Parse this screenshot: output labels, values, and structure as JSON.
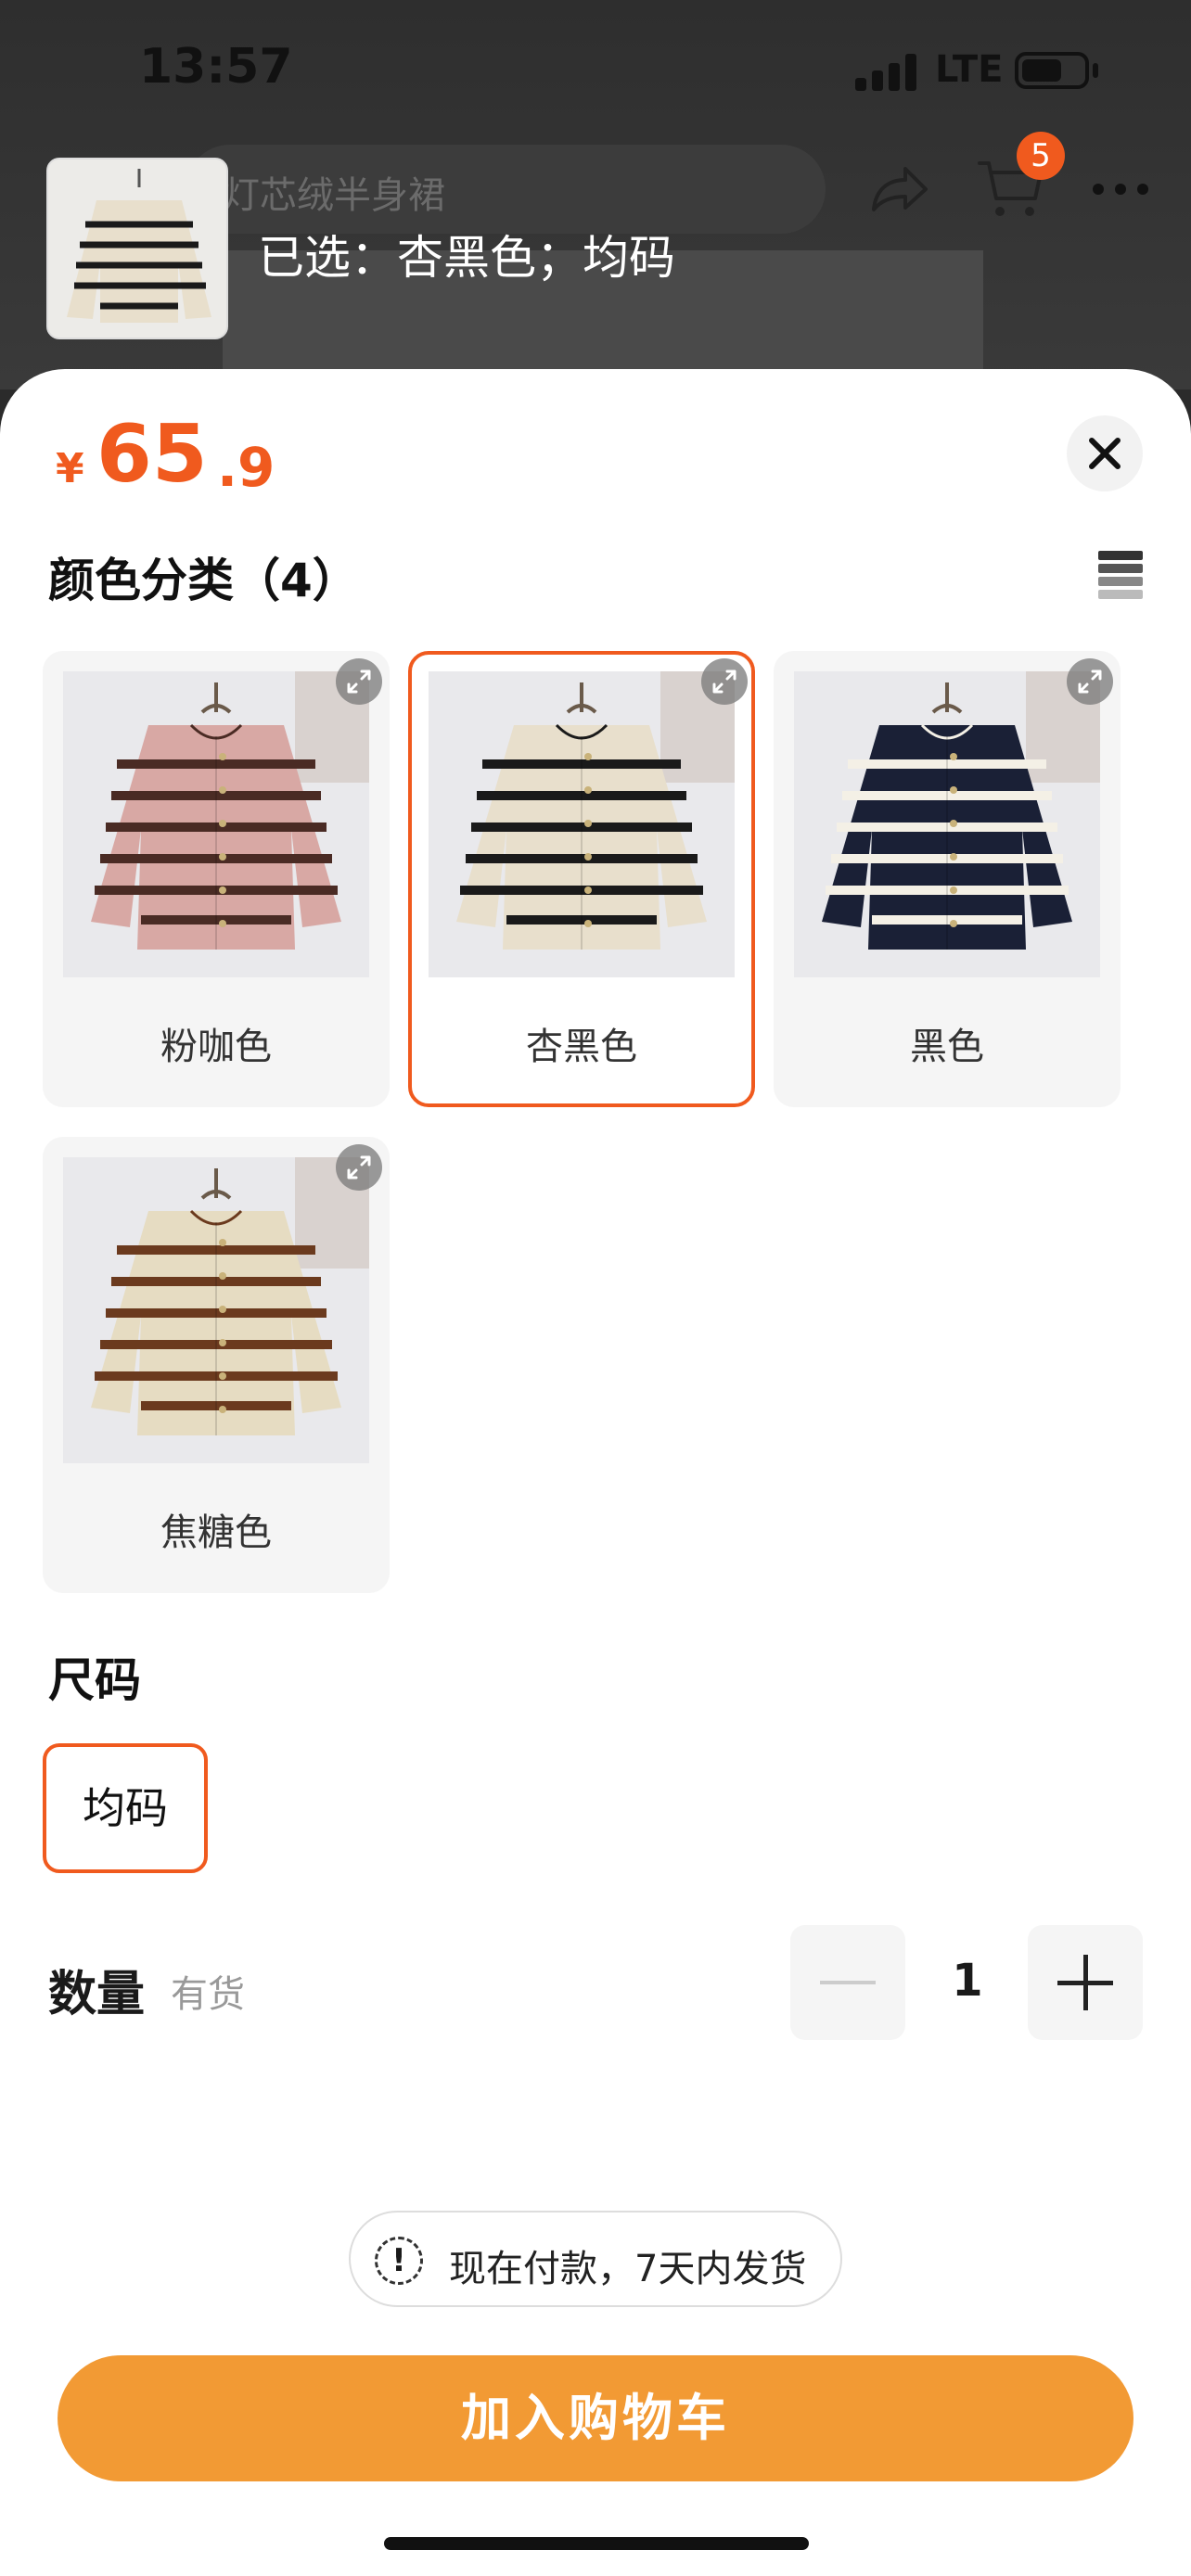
{
  "status_bar": {
    "time": "13:57",
    "network": "LTE"
  },
  "background_header": {
    "search_text": "灯芯绒半身裙",
    "cart_badge": "5",
    "selected_text": "已选：杏黑色；均码"
  },
  "price": {
    "currency": "¥",
    "integer": "65",
    "decimal": ".9"
  },
  "color_section": {
    "title": "颜色分类（4）",
    "options": [
      {
        "label": "粉咖色",
        "body_color": "#d8a8a4",
        "stripe_color": "#4a2b24",
        "selected": false
      },
      {
        "label": "杏黑色",
        "body_color": "#e8dfcc",
        "stripe_color": "#1a1a1a",
        "selected": true
      },
      {
        "label": "黑色",
        "body_color": "#1a2036",
        "stripe_color": "#f4f0e6",
        "selected": false
      },
      {
        "label": "焦糖色",
        "body_color": "#e6dcc2",
        "stripe_color": "#6b3a1e",
        "selected": false
      }
    ]
  },
  "size_section": {
    "title": "尺码",
    "option": "均码"
  },
  "quantity": {
    "label": "数量",
    "stock": "有货",
    "value": "1"
  },
  "notice": {
    "icon": "!",
    "text": "现在付款，7天内发货"
  },
  "cta": {
    "add_to_cart": "加入购物车"
  },
  "colors": {
    "accent": "#f05a1e",
    "cta": "#f29a34"
  }
}
